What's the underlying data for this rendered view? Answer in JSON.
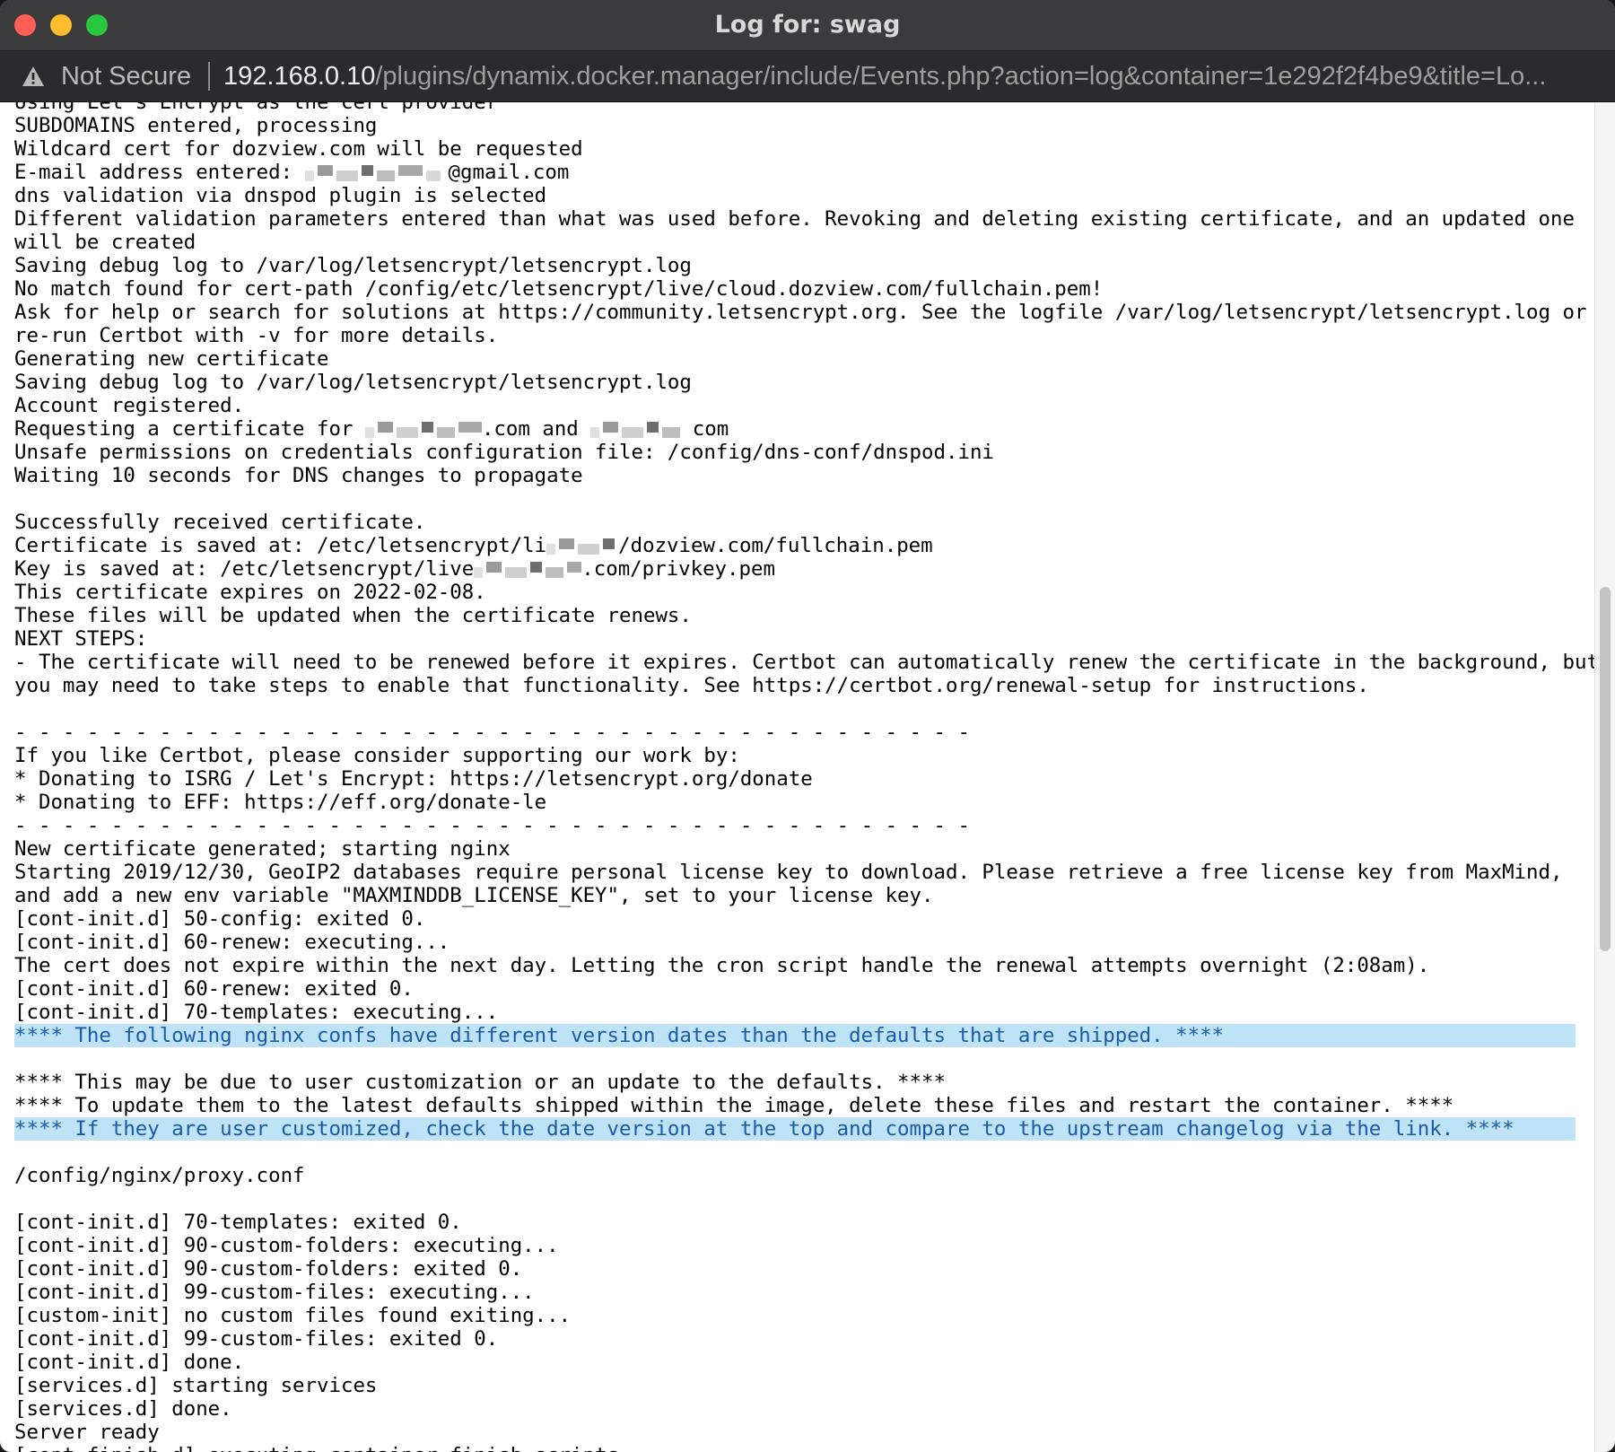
{
  "window": {
    "title": "Log for: swag"
  },
  "address_bar": {
    "security_label": "Not Secure",
    "url_host": "192.168.0.10",
    "url_path": "/plugins/dynamix.docker.manager/include/Events.php?action=log&container=1e292f2f4be9&title=Lo..."
  },
  "log": {
    "lines": [
      {
        "text": "Using Let's Encrypt as the cert provider"
      },
      {
        "text": "SUBDOMAINS entered, processing"
      },
      {
        "text": "Wildcard cert for dozview.com will be requested"
      },
      {
        "text": "E-mail address entered: ",
        "redacted_after": true,
        "suffix": "@gmail.com"
      },
      {
        "text": "dns validation via dnspod plugin is selected"
      },
      {
        "text": "Different validation parameters entered than what was used before. Revoking and deleting existing certificate, and an updated one"
      },
      {
        "text": "will be created"
      },
      {
        "text": "Saving debug log to /var/log/letsencrypt/letsencrypt.log"
      },
      {
        "text": "No match found for cert-path /config/etc/letsencrypt/live/cloud.dozview.com/fullchain.pem!"
      },
      {
        "text": "Ask for help or search for solutions at https://community.letsencrypt.org. See the logfile /var/log/letsencrypt/letsencrypt.log or"
      },
      {
        "text": "re-run Certbot with -v for more details."
      },
      {
        "text": "Generating new certificate"
      },
      {
        "text": "Saving debug log to /var/log/letsencrypt/letsencrypt.log"
      },
      {
        "text": "Account registered."
      },
      {
        "text": "Requesting a certificate for ",
        "redacted_after": true,
        "suffix": ".com and ",
        "redacted_after2": true,
        "suffix2": " com"
      },
      {
        "text": "Unsafe permissions on credentials configuration file: /config/dns-conf/dnspod.ini"
      },
      {
        "text": "Waiting 10 seconds for DNS changes to propagate"
      },
      {
        "text": ""
      },
      {
        "text": "Successfully received certificate."
      },
      {
        "text": "Certificate is saved at: /etc/letsencrypt/li",
        "redacted_after": true,
        "suffix": "/dozview.com/fullchain.pem"
      },
      {
        "text": "Key is saved at: /etc/letsencrypt/live",
        "redacted_after": true,
        "suffix": ".com/privkey.pem"
      },
      {
        "text": "This certificate expires on 2022-02-08."
      },
      {
        "text": "These files will be updated when the certificate renews."
      },
      {
        "text": "NEXT STEPS:"
      },
      {
        "text": "- The certificate will need to be renewed before it expires. Certbot can automatically renew the certificate in the background, but"
      },
      {
        "text": "you may need to take steps to enable that functionality. See https://certbot.org/renewal-setup for instructions."
      },
      {
        "text": ""
      },
      {
        "text": "- - - - - - - - - - - - - - - - - - - - - - - - - - - - - - - - - - - - - - - -"
      },
      {
        "text": "If you like Certbot, please consider supporting our work by:"
      },
      {
        "text": "* Donating to ISRG / Let's Encrypt: https://letsencrypt.org/donate"
      },
      {
        "text": "* Donating to EFF: https://eff.org/donate-le"
      },
      {
        "text": "- - - - - - - - - - - - - - - - - - - - - - - - - - - - - - - - - - - - - - - -"
      },
      {
        "text": "New certificate generated; starting nginx"
      },
      {
        "text": "Starting 2019/12/30, GeoIP2 databases require personal license key to download. Please retrieve a free license key from MaxMind,"
      },
      {
        "text": "and add a new env variable \"MAXMINDDB_LICENSE_KEY\", set to your license key."
      },
      {
        "text": "[cont-init.d] 50-config: exited 0."
      },
      {
        "text": "[cont-init.d] 60-renew: executing..."
      },
      {
        "text": "The cert does not expire within the next day. Letting the cron script handle the renewal attempts overnight (2:08am)."
      },
      {
        "text": "[cont-init.d] 60-renew: exited 0."
      },
      {
        "text": "[cont-init.d] 70-templates: executing..."
      },
      {
        "text": "**** The following nginx confs have different version dates than the defaults that are shipped. ****",
        "highlight": true
      },
      {
        "text": ""
      },
      {
        "text": "**** This may be due to user customization or an update to the defaults. ****"
      },
      {
        "text": "**** To update them to the latest defaults shipped within the image, delete these files and restart the container. ****"
      },
      {
        "text": "**** If they are user customized, check the date version at the top and compare to the upstream changelog via the link. ****",
        "highlight": true
      },
      {
        "text": ""
      },
      {
        "text": "/config/nginx/proxy.conf"
      },
      {
        "text": ""
      },
      {
        "text": "[cont-init.d] 70-templates: exited 0."
      },
      {
        "text": "[cont-init.d] 90-custom-folders: executing..."
      },
      {
        "text": "[cont-init.d] 90-custom-folders: exited 0."
      },
      {
        "text": "[cont-init.d] 99-custom-files: executing..."
      },
      {
        "text": "[custom-init] no custom files found exiting..."
      },
      {
        "text": "[cont-init.d] 99-custom-files: exited 0."
      },
      {
        "text": "[cont-init.d] done."
      },
      {
        "text": "[services.d] starting services"
      },
      {
        "text": "[services.d] done."
      },
      {
        "text": "Server ready"
      },
      {
        "text": "[cont-finish.d] executing container finish scripts..."
      }
    ]
  },
  "colors": {
    "highlight_bg": "#bfe3f6",
    "highlight_text": "#1a5aa8"
  }
}
